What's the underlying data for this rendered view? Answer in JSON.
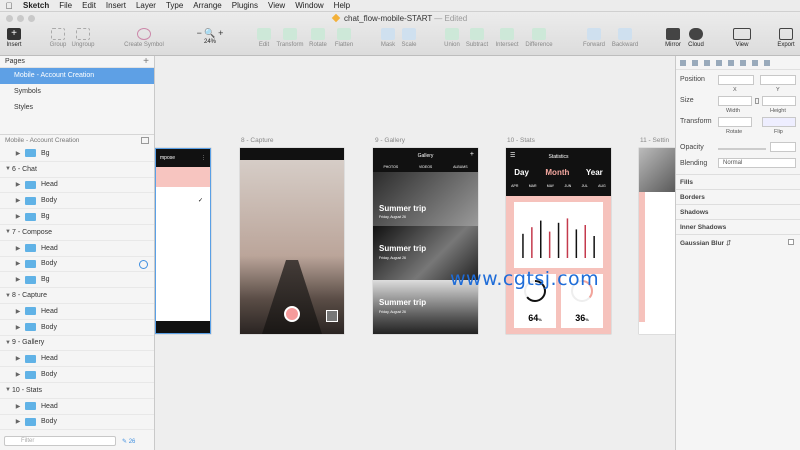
{
  "menubar": {
    "items": [
      "Sketch",
      "File",
      "Edit",
      "Insert",
      "Layer",
      "Type",
      "Arrange",
      "Plugins",
      "View",
      "Window",
      "Help"
    ]
  },
  "document": {
    "title": "chat_flow-mobile-START",
    "status": "— Edited"
  },
  "toolbar": {
    "insert": "Insert",
    "group": "Group",
    "ungroup": "Ungroup",
    "create_symbol": "Create Symbol",
    "zoom": "24%",
    "edit": "Edit",
    "transform": "Transform",
    "rotate": "Rotate",
    "flatten": "Flatten",
    "mask": "Mask",
    "scale": "Scale",
    "union": "Union",
    "subtract": "Subtract",
    "intersect": "Intersect",
    "difference": "Difference",
    "forward": "Forward",
    "backward": "Backward",
    "mirror": "Mirror",
    "cloud": "Cloud",
    "view": "View",
    "export": "Export"
  },
  "pages": {
    "header": "Pages",
    "items": [
      "Mobile - Account Creation",
      "Symbols",
      "Styles"
    ]
  },
  "layers": {
    "header": "Mobile - Account Creation",
    "rows": [
      {
        "label": "Bg",
        "kind": "child"
      },
      {
        "label": "6 - Chat",
        "kind": "group"
      },
      {
        "label": "Head",
        "kind": "child"
      },
      {
        "label": "Body",
        "kind": "child"
      },
      {
        "label": "Bg",
        "kind": "child"
      },
      {
        "label": "7 - Compose",
        "kind": "group"
      },
      {
        "label": "Head",
        "kind": "child"
      },
      {
        "label": "Body",
        "kind": "child"
      },
      {
        "label": "Bg",
        "kind": "child"
      },
      {
        "label": "8 - Capture",
        "kind": "group"
      },
      {
        "label": "Head",
        "kind": "child"
      },
      {
        "label": "Body",
        "kind": "child"
      },
      {
        "label": "9 - Gallery",
        "kind": "group"
      },
      {
        "label": "Head",
        "kind": "child"
      },
      {
        "label": "Body",
        "kind": "child"
      },
      {
        "label": "10 - Stats",
        "kind": "group"
      },
      {
        "label": "Head",
        "kind": "child"
      },
      {
        "label": "Body",
        "kind": "child"
      }
    ],
    "filter_placeholder": "Filter",
    "count": "26"
  },
  "canvas": {
    "artboards": {
      "compose": {
        "label": "",
        "header": "mpose"
      },
      "capture": {
        "label": "8 - Capture"
      },
      "gallery": {
        "label": "9 - Gallery",
        "header": "Gallery",
        "tabs": [
          "PHOTOS",
          "VIDEOS",
          "ALBUMS"
        ],
        "items": [
          {
            "title": "Summer trip",
            "date": "Friday, August 26"
          },
          {
            "title": "Summer trip",
            "date": "Friday, August 26"
          },
          {
            "title": "Summer trip",
            "date": "Friday, August 26"
          }
        ]
      },
      "stats": {
        "label": "10 - Stats",
        "header": "Statistics",
        "periods": [
          "Day",
          "Month",
          "Year"
        ],
        "months": [
          "APR",
          "MAR",
          "MAY",
          "JUN",
          "JUL",
          "AUG"
        ],
        "bars": [
          0.55,
          0.7,
          0.85,
          0.6,
          0.8,
          0.9,
          0.65,
          0.75,
          0.5
        ],
        "gauge1": {
          "value": "64",
          "unit": "%",
          "progress": 0.64
        },
        "gauge2": {
          "value": "36",
          "unit": "%",
          "progress": 0.36
        }
      },
      "settings": {
        "label": "11 - Settin"
      }
    },
    "watermark": "www.cgtsj.com"
  },
  "inspector": {
    "position": "Position",
    "x": "X",
    "y": "Y",
    "size": "Size",
    "width": "Width",
    "height": "Height",
    "transform": "Transform",
    "rotate": "Rotate",
    "flip": "Flip",
    "opacity": "Opacity",
    "blending": "Blending",
    "blending_value": "Normal",
    "sections": [
      "Fills",
      "Borders",
      "Shadows",
      "Inner Shadows",
      "Gaussian Blur"
    ]
  }
}
